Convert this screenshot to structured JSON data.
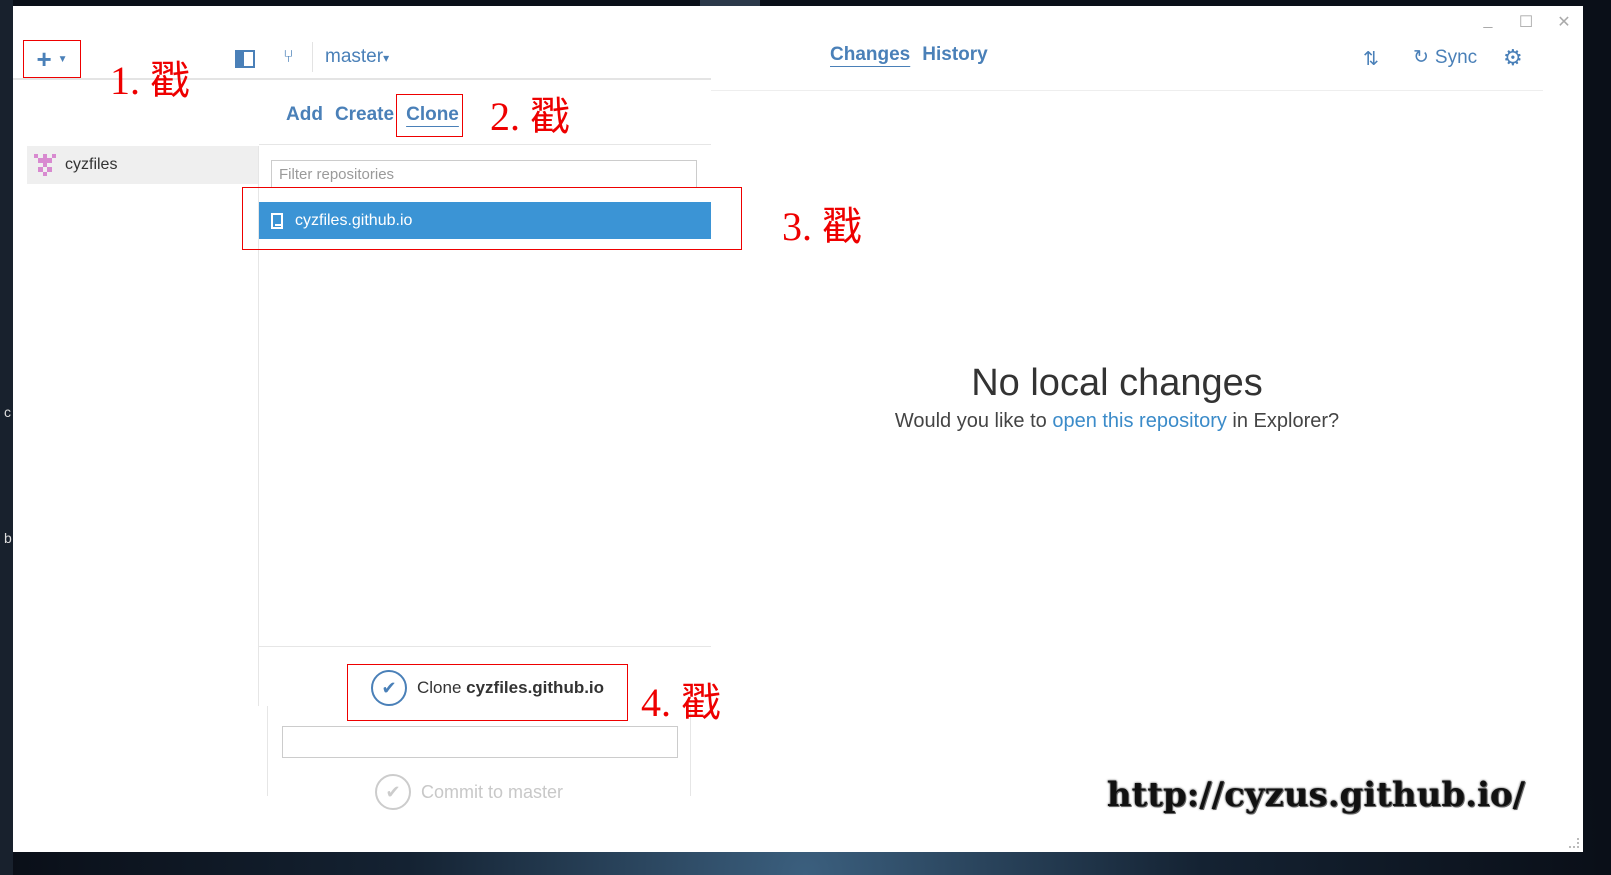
{
  "toolbar": {
    "add_icon": "plus-icon",
    "branch_name": "master",
    "branch_caret": "▾"
  },
  "sidebar": {
    "repos": [
      {
        "name": "cyzfiles",
        "identicon_color": "#d88ad0"
      }
    ]
  },
  "popover": {
    "tabs": [
      "Add",
      "Create",
      "Clone"
    ],
    "active_tab": "Clone",
    "filter_placeholder": "Filter repositories",
    "repositories": [
      {
        "label": "cyzfiles.github.io"
      }
    ],
    "confirm_prefix": "Clone ",
    "confirm_repo": "cyzfiles.github.io"
  },
  "commit": {
    "button_label": "Commit to master"
  },
  "main": {
    "tabs": [
      "Changes",
      "History"
    ],
    "active_tab": "Changes",
    "sync_label": "Sync",
    "empty_title": "No local changes",
    "empty_sub_before": "Would you like to ",
    "empty_sub_link": "open this repository",
    "empty_sub_after": " in Explorer?"
  },
  "annotations": {
    "step1": "1. 戳",
    "step2": "2. 戳",
    "step3": "3. 戳",
    "step4": "4. 戳",
    "color": "#ee0000"
  },
  "watermark": "http://cyzus.github.io/",
  "desktop": {
    "edge_letters": [
      "c",
      "b"
    ]
  },
  "colors": {
    "accent": "#4a80b8",
    "selection": "#3b94d5",
    "link": "#3b8bc9"
  }
}
